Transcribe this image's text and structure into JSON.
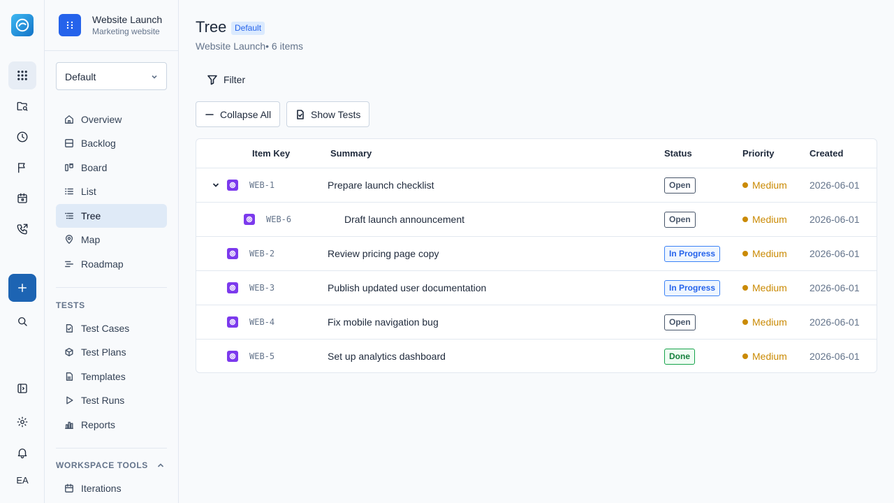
{
  "rail": {
    "initials": "EA"
  },
  "project": {
    "name": "Website Launch",
    "subtitle": "Marketing website"
  },
  "board_select": {
    "value": "Default"
  },
  "nav": {
    "items": [
      {
        "label": "Overview",
        "icon": "home-icon"
      },
      {
        "label": "Backlog",
        "icon": "backlog-icon"
      },
      {
        "label": "Board",
        "icon": "board-icon"
      },
      {
        "label": "List",
        "icon": "list-icon"
      },
      {
        "label": "Tree",
        "icon": "tree-icon",
        "active": true
      },
      {
        "label": "Map",
        "icon": "map-pin-icon"
      },
      {
        "label": "Roadmap",
        "icon": "roadmap-icon"
      }
    ],
    "tests_title": "TESTS",
    "tests": [
      {
        "label": "Test Cases",
        "icon": "test-case-icon"
      },
      {
        "label": "Test Plans",
        "icon": "test-plan-icon"
      },
      {
        "label": "Templates",
        "icon": "template-icon"
      },
      {
        "label": "Test Runs",
        "icon": "play-icon"
      },
      {
        "label": "Reports",
        "icon": "bar-chart-icon"
      }
    ],
    "tools_title": "WORKSPACE TOOLS",
    "tools": [
      {
        "label": "Iterations",
        "icon": "calendar-icon"
      }
    ]
  },
  "main": {
    "title": "Tree",
    "badge": "Default",
    "subtitle": "Website Launch• 6 items",
    "filter_label": "Filter",
    "collapse_label": "Collapse All",
    "show_tests_label": "Show Tests"
  },
  "table": {
    "columns": {
      "key": "Item Key",
      "summary": "Summary",
      "status": "Status",
      "priority": "Priority",
      "created": "Created"
    },
    "rows": [
      {
        "key": "WEB-1",
        "summary": "Prepare launch checklist",
        "status": "Open",
        "priority": "Medium",
        "created": "2026-06-01"
      },
      {
        "key": "WEB-6",
        "summary": "Draft launch announcement",
        "status": "Open",
        "priority": "Medium",
        "created": "2026-06-01"
      },
      {
        "key": "WEB-2",
        "summary": "Review pricing page copy",
        "status": "In Progress",
        "priority": "Medium",
        "created": "2026-06-01"
      },
      {
        "key": "WEB-3",
        "summary": "Publish updated user documentation",
        "status": "In Progress",
        "priority": "Medium",
        "created": "2026-06-01"
      },
      {
        "key": "WEB-4",
        "summary": "Fix mobile navigation bug",
        "status": "Open",
        "priority": "Medium",
        "created": "2026-06-01"
      },
      {
        "key": "WEB-5",
        "summary": "Set up analytics dashboard",
        "status": "Done",
        "priority": "Medium",
        "created": "2026-06-01"
      }
    ]
  },
  "colors": {
    "accent": "#2563eb",
    "active_nav": "#dfeaf7",
    "create_button": "#1d64b3",
    "issue_type": "#7c3aed",
    "priority_medium": "#ca8a04"
  }
}
